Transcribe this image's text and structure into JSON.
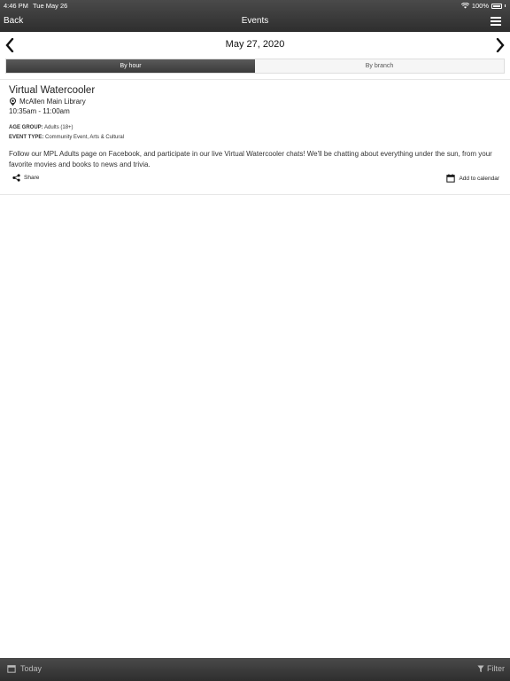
{
  "status_bar": {
    "time": "4:46 PM",
    "date": "Tue May 26",
    "battery": "100%"
  },
  "nav": {
    "back_label": "Back",
    "title": "Events"
  },
  "date_nav": {
    "date": "May 27, 2020"
  },
  "segments": [
    {
      "label": "By hour",
      "selected": true
    },
    {
      "label": "By branch",
      "selected": false
    }
  ],
  "event": {
    "title": "Virtual Watercooler",
    "location": "McAllen Main Library",
    "time": "10:35am - 11:00am",
    "age_group_label": "AGE GROUP:",
    "age_group": "Adults (18+)",
    "event_type_label": "EVENT TYPE:",
    "event_type": "Community Event, Arts & Cultural",
    "description": "Follow our MPL Adults page on Facebook, and participate in our live Virtual Watercooler chats! We'll be chatting about everything under the sun, from your favorite movies and books to news and trivia.",
    "share_label": "Share",
    "add_calendar_label": "Add to calendar"
  },
  "bottom_bar": {
    "today_label": "Today",
    "filter_label": "Filter"
  },
  "colors": {
    "bar_dark": "#3a3a3a",
    "text": "#222222",
    "segment_inactive": "#f6f6f6"
  }
}
